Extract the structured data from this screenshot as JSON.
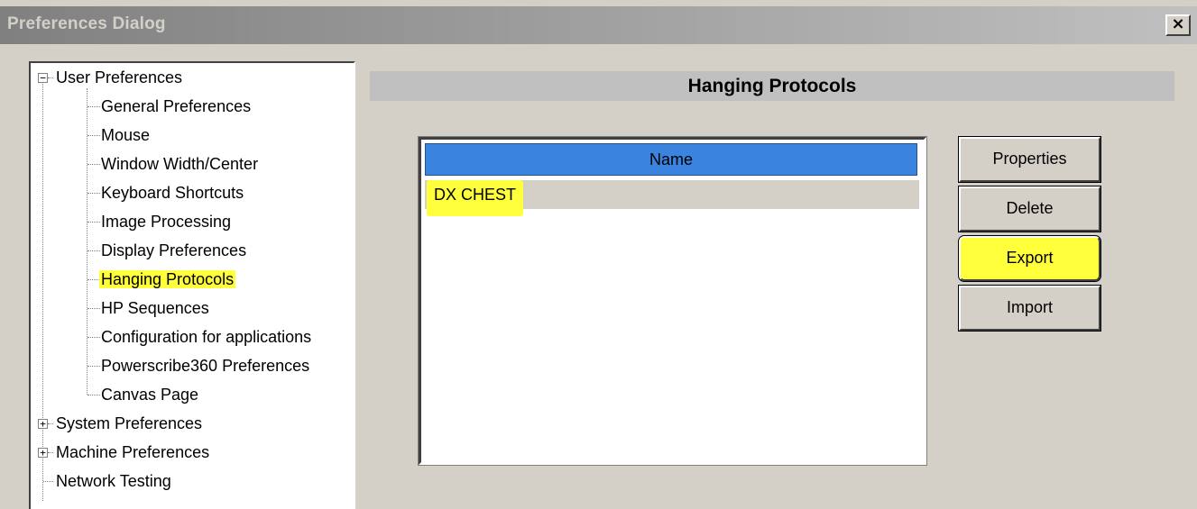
{
  "window": {
    "title": "Preferences Dialog",
    "close_label": "×"
  },
  "tree": {
    "root": {
      "label": "User Preferences",
      "expander": "−",
      "children": [
        {
          "label": "General Preferences"
        },
        {
          "label": "Mouse"
        },
        {
          "label": "Window Width/Center"
        },
        {
          "label": "Keyboard Shortcuts"
        },
        {
          "label": "Image Processing"
        },
        {
          "label": "Display Preferences"
        },
        {
          "label": "Hanging Protocols",
          "selected": true
        },
        {
          "label": "HP Sequences"
        },
        {
          "label": "Configuration for applications"
        },
        {
          "label": "Powerscribe360 Preferences"
        },
        {
          "label": "Canvas Page"
        }
      ]
    },
    "others": [
      {
        "label": "System Preferences",
        "expander": "+"
      },
      {
        "label": "Machine Preferences",
        "expander": "+"
      },
      {
        "label": "Network Testing"
      }
    ]
  },
  "panel": {
    "title": "Hanging Protocols",
    "list": {
      "column_header": "Name",
      "rows": [
        "DX CHEST"
      ]
    },
    "buttons": {
      "properties": "Properties",
      "delete": "Delete",
      "export": "Export",
      "import": "Import"
    }
  },
  "colors": {
    "highlight": "#ffff3c",
    "list_header": "#3a84e0",
    "dialog_face": "#d4d0c8"
  }
}
